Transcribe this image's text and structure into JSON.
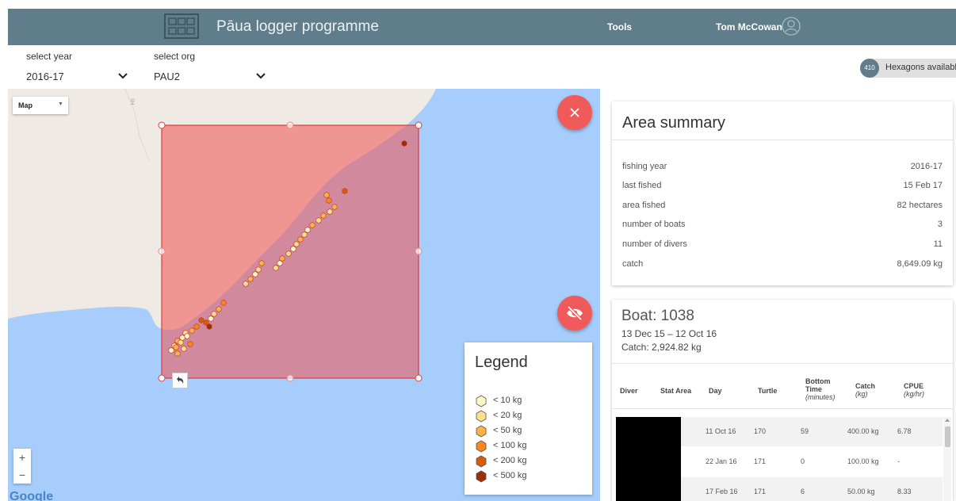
{
  "header": {
    "app_title": "Pāua logger programme",
    "tools_label": "Tools",
    "user_name": "Tom McCowan",
    "background_color": "#5f7d8a"
  },
  "filters": {
    "year": {
      "label": "select year",
      "value": "2016-17"
    },
    "org": {
      "label": "select org",
      "value": "PAU2"
    }
  },
  "hexagons": {
    "count": "410",
    "label": "Hexagons available"
  },
  "map": {
    "type_label": "Map",
    "zoom_in_label": "+",
    "zoom_out_label": "−",
    "attribution": "Google",
    "water_color": "#a6cdfb",
    "land_color": "#efeae3",
    "selection_color": "#f0595a",
    "icons": [
      "close-icon",
      "eye-off-icon",
      "undo-icon"
    ]
  },
  "legend": {
    "title": "Legend",
    "items": [
      {
        "label": "< 10 kg",
        "color": "#fff8c8"
      },
      {
        "label": "< 20 kg",
        "color": "#fde08a"
      },
      {
        "label": "< 50 kg",
        "color": "#fcb347"
      },
      {
        "label": "< 100 kg",
        "color": "#f8871e"
      },
      {
        "label": "< 200 kg",
        "color": "#d85a0d"
      },
      {
        "label": "< 500 kg",
        "color": "#9c2f05"
      }
    ]
  },
  "area_summary": {
    "title": "Area summary",
    "rows": [
      {
        "label": "fishing year",
        "value": "2016-17"
      },
      {
        "label": "last fished",
        "value": "15 Feb 17"
      },
      {
        "label": "area fished",
        "value": "82 hectares"
      },
      {
        "label": "number of boats",
        "value": "3"
      },
      {
        "label": "number of divers",
        "value": "11"
      },
      {
        "label": "catch",
        "value": "8,649.09 kg"
      }
    ]
  },
  "boat": {
    "title": "Boat: 1038",
    "dates": "13 Dec 15 – 12 Oct 16",
    "catch": "Catch: 2,924.82 kg",
    "columns": {
      "diver": "Diver",
      "stat_area": "Stat Area",
      "day": "Day",
      "turtle": "Turtle",
      "bottom_time_1": "Bottom",
      "bottom_time_2": "Time",
      "bottom_time_unit": "(minutes)",
      "catch": "Catch",
      "catch_unit": "(kg)",
      "cpue": "CPUE",
      "cpue_unit": "(kg/hr)"
    },
    "rows": [
      {
        "day": "11 Oct 16",
        "turtle": "170",
        "bottom_time": "59",
        "catch": "400.00 kg",
        "cpue": "6.78"
      },
      {
        "day": "22 Jan 16",
        "turtle": "171",
        "bottom_time": "0",
        "catch": "100.00 kg",
        "cpue": "-"
      },
      {
        "day": "17 Feb 16",
        "turtle": "171",
        "bottom_time": "6",
        "catch": "50.00 kg",
        "cpue": "8.33"
      }
    ]
  }
}
